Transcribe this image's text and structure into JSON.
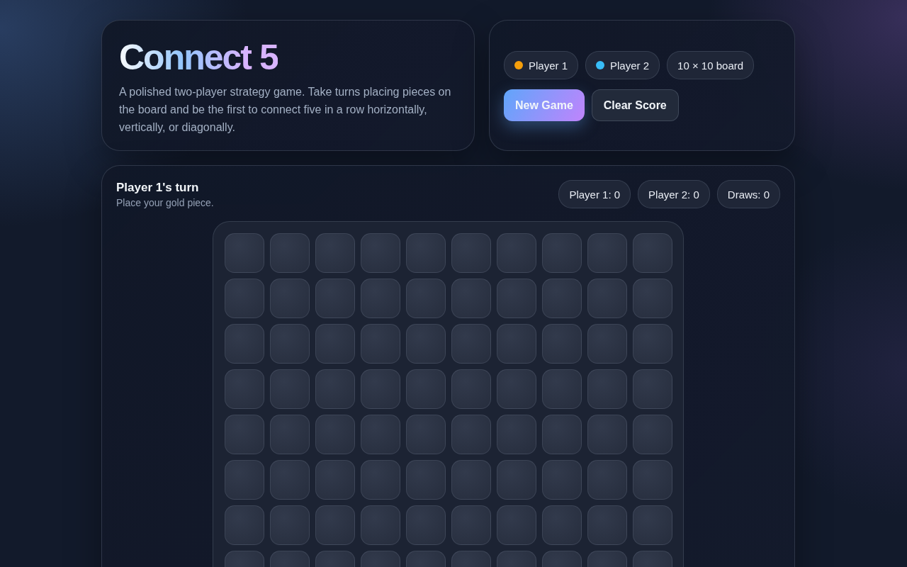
{
  "header": {
    "title": "Connect 5",
    "description": "A polished two-player strategy game. Take turns placing pieces on the board and be the first to connect five in a row horizontally, vertically, or diagonally."
  },
  "legend": [
    {
      "label": "Player 1",
      "color": "#f59e0b"
    },
    {
      "label": "Player 2",
      "color": "#38bdf8"
    },
    {
      "label": "10 × 10 board"
    }
  ],
  "buttons": [
    {
      "label": "New Game",
      "kind": "primary"
    },
    {
      "label": "Clear Score",
      "kind": "secondary"
    }
  ],
  "status": {
    "turn": "Player 1's turn",
    "hint": "Place your gold piece."
  },
  "scores": [
    "Player 1: 0",
    "Player 2: 0",
    "Draws: 0"
  ],
  "board": {
    "rows": [
      [
        {
          "filled": false
        },
        {
          "filled": false
        },
        {
          "filled": false
        },
        {
          "filled": false
        },
        {
          "filled": false
        },
        {
          "filled": false
        },
        {
          "filled": false
        },
        {
          "filled": false
        },
        {
          "filled": false
        },
        {
          "filled": false
        }
      ],
      [
        {
          "filled": false
        },
        {
          "filled": false
        },
        {
          "filled": false
        },
        {
          "filled": false
        },
        {
          "filled": false
        },
        {
          "filled": false
        },
        {
          "filled": false
        },
        {
          "filled": false
        },
        {
          "filled": false
        },
        {
          "filled": false
        }
      ],
      [
        {
          "filled": false
        },
        {
          "filled": false
        },
        {
          "filled": false
        },
        {
          "filled": false
        },
        {
          "filled": false
        },
        {
          "filled": false
        },
        {
          "filled": false
        },
        {
          "filled": false
        },
        {
          "filled": false
        },
        {
          "filled": false
        }
      ],
      [
        {
          "filled": false
        },
        {
          "filled": false
        },
        {
          "filled": false
        },
        {
          "filled": false
        },
        {
          "filled": false
        },
        {
          "filled": false
        },
        {
          "filled": false
        },
        {
          "filled": false
        },
        {
          "filled": false
        },
        {
          "filled": false
        }
      ],
      [
        {
          "filled": false
        },
        {
          "filled": false
        },
        {
          "filled": false
        },
        {
          "filled": false
        },
        {
          "filled": false
        },
        {
          "filled": false
        },
        {
          "filled": false
        },
        {
          "filled": false
        },
        {
          "filled": false
        },
        {
          "filled": false
        }
      ],
      [
        {
          "filled": false
        },
        {
          "filled": false
        },
        {
          "filled": false
        },
        {
          "filled": false
        },
        {
          "filled": false
        },
        {
          "filled": false
        },
        {
          "filled": false
        },
        {
          "filled": false
        },
        {
          "filled": false
        },
        {
          "filled": false
        }
      ],
      [
        {
          "filled": false
        },
        {
          "filled": false
        },
        {
          "filled": false
        },
        {
          "filled": false
        },
        {
          "filled": false
        },
        {
          "filled": false
        },
        {
          "filled": false
        },
        {
          "filled": false
        },
        {
          "filled": false
        },
        {
          "filled": false
        }
      ],
      [
        {
          "filled": false
        },
        {
          "filled": false
        },
        {
          "filled": false
        },
        {
          "filled": false
        },
        {
          "filled": false
        },
        {
          "filled": false
        },
        {
          "filled": false
        },
        {
          "filled": false
        },
        {
          "filled": false
        },
        {
          "filled": false
        }
      ]
    ]
  }
}
